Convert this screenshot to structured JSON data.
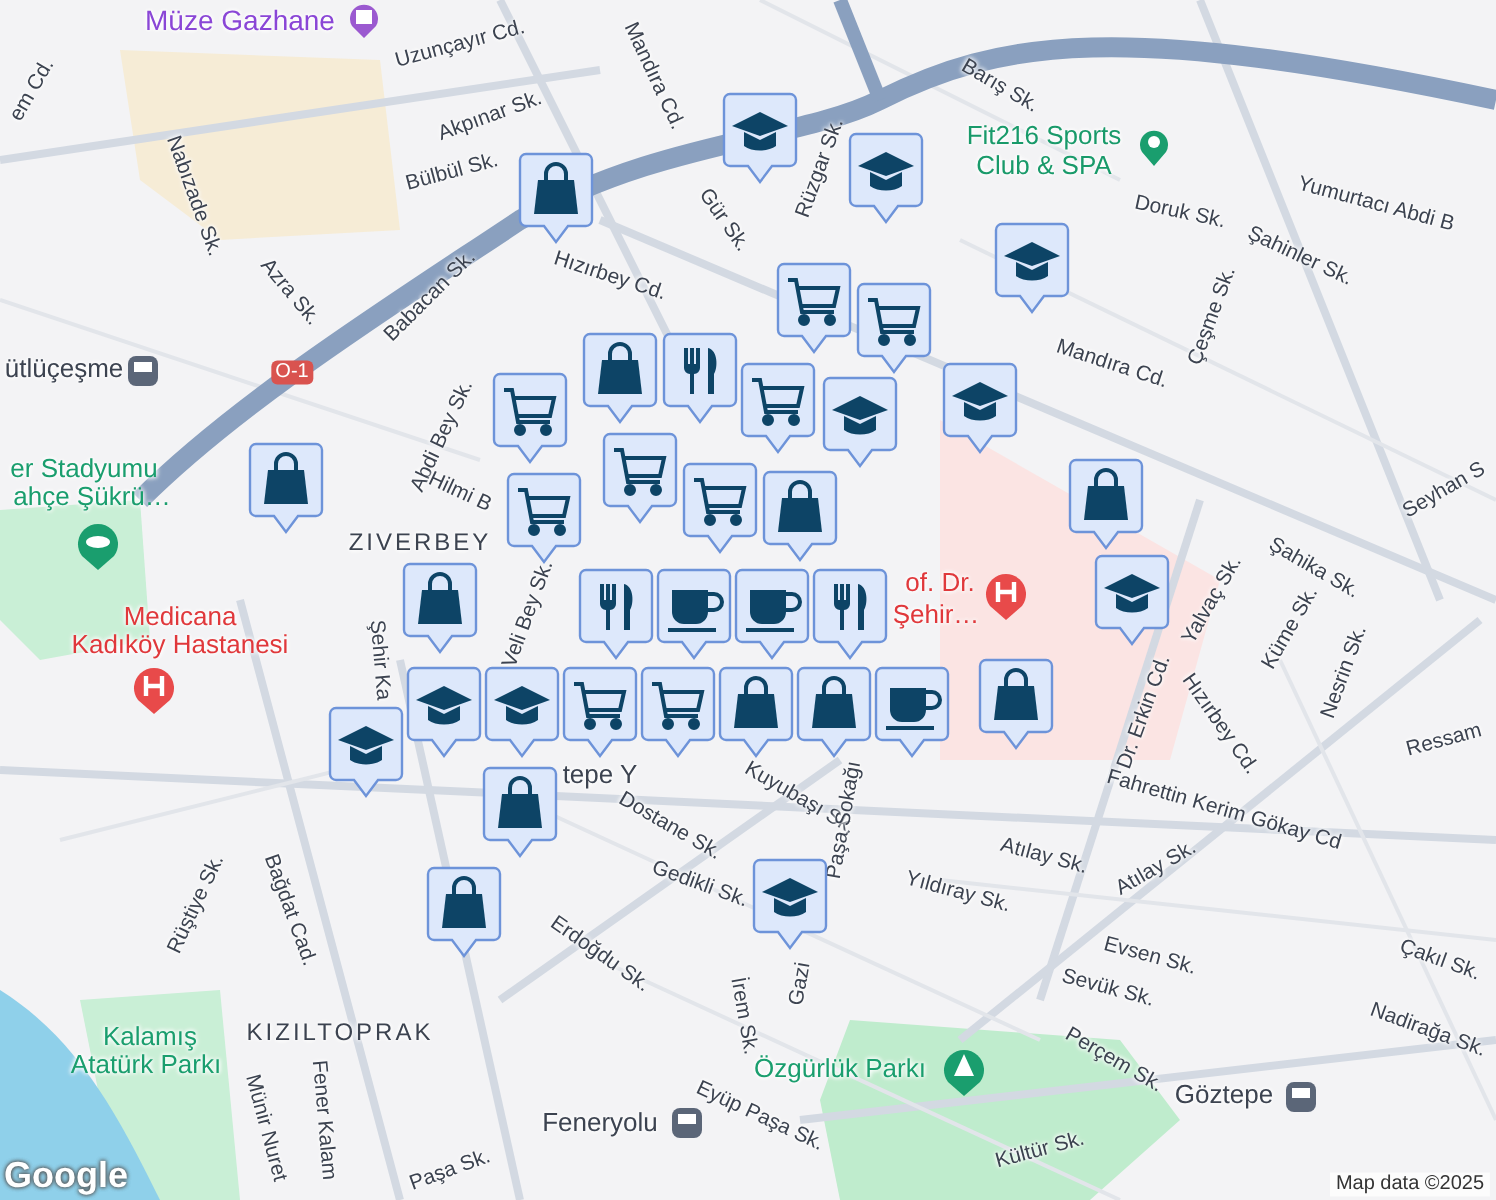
{
  "labels": [
    {
      "text": "em Cd.",
      "kind": "street"
    },
    {
      "text": "Müze Gazhane",
      "kind": "museum"
    },
    {
      "text": "Uzunçayır Cd.",
      "kind": "street"
    },
    {
      "text": "Mandıra Cd.",
      "kind": "street"
    },
    {
      "text": "Akpınar Sk.",
      "kind": "street"
    },
    {
      "text": "Bülbül Sk.",
      "kind": "street"
    },
    {
      "text": "Nabızade Sk.",
      "kind": "street"
    },
    {
      "text": "Azra Sk.",
      "kind": "street"
    },
    {
      "text": "Babacan Sk.",
      "kind": "street"
    },
    {
      "text": "Hızırbey Cd.",
      "kind": "street"
    },
    {
      "text": "Gür Sk.",
      "kind": "street"
    },
    {
      "text": "Rüzgar Sk.",
      "kind": "street"
    },
    {
      "text": "Barış Sk.",
      "kind": "street"
    },
    {
      "text": "Fit216 Sports Club & SPA",
      "kind": "sport"
    },
    {
      "text": "Doruk Sk.",
      "kind": "street"
    },
    {
      "text": "Şahinler Sk.",
      "kind": "street"
    },
    {
      "text": "Yumurtacı Abdi B",
      "kind": "street"
    },
    {
      "text": "Çeşme Sk.",
      "kind": "street"
    },
    {
      "text": "Mandıra Cd.",
      "kind": "street"
    },
    {
      "text": "Seyhan S",
      "kind": "street"
    },
    {
      "text": "Şahika Sk.",
      "kind": "street"
    },
    {
      "text": "ütlüçeşme",
      "kind": "station"
    },
    {
      "text": "er Stadyumu",
      "kind": "park"
    },
    {
      "text": "ahçe Şükrü…",
      "kind": "park"
    },
    {
      "text": "Abdi Bey Sk.",
      "kind": "street"
    },
    {
      "text": "Hilmi B",
      "kind": "street"
    },
    {
      "text": "ZIVERBEY",
      "kind": "district"
    },
    {
      "text": "Veli Bey Sk.",
      "kind": "street"
    },
    {
      "text": "of. Dr.",
      "kind": "hospital"
    },
    {
      "text": "Şehir…",
      "kind": "hospital"
    },
    {
      "text": "Medicana",
      "kind": "hospital"
    },
    {
      "text": "Kadıköy Hastanesi",
      "kind": "hospital"
    },
    {
      "text": "Şehir Ka",
      "kind": "street"
    },
    {
      "text": "tepe Y",
      "kind": "station"
    },
    {
      "text": "Dostane Sk.",
      "kind": "street"
    },
    {
      "text": "Kuyubaşı Sk.",
      "kind": "street"
    },
    {
      "text": "Gedikli Sk.",
      "kind": "street"
    },
    {
      "text": "Erdoğdu Sk.",
      "kind": "street"
    },
    {
      "text": "Rüştiye Sk.",
      "kind": "street"
    },
    {
      "text": "Bağdat Cad.",
      "kind": "street"
    },
    {
      "text": "İrem Sk.",
      "kind": "street"
    },
    {
      "text": "Paşa Sokağı",
      "kind": "street"
    },
    {
      "text": "Gazi",
      "kind": "street"
    },
    {
      "text": "Dr. Erkin Cd.",
      "kind": "street"
    },
    {
      "text": "Yalvaç Sk.",
      "kind": "street"
    },
    {
      "text": "Küme Sk.",
      "kind": "street"
    },
    {
      "text": "Nesrin Sk.",
      "kind": "street"
    },
    {
      "text": "Hızırbey Cd.",
      "kind": "street"
    },
    {
      "text": "Ressam",
      "kind": "street"
    },
    {
      "text": "Fahrettin Kerim Gökay Cd",
      "kind": "street"
    },
    {
      "text": "Atılay Sk.",
      "kind": "street"
    },
    {
      "text": "Atılay Sk.",
      "kind": "street"
    },
    {
      "text": "Yıldıray Sk.",
      "kind": "street"
    },
    {
      "text": "Evsen Sk.",
      "kind": "street"
    },
    {
      "text": "Sevük Sk.",
      "kind": "street"
    },
    {
      "text": "Çakıl Sk.",
      "kind": "street"
    },
    {
      "text": "Nadirağa Sk.",
      "kind": "street"
    },
    {
      "text": "Perçem Sk.",
      "kind": "street"
    },
    {
      "text": "KIZILTOPRAK",
      "kind": "district"
    },
    {
      "text": "Kalamış",
      "kind": "park"
    },
    {
      "text": "Atatürk Parkı",
      "kind": "park"
    },
    {
      "text": "Özgürlük Parkı",
      "kind": "park"
    },
    {
      "text": "Göztepe",
      "kind": "station"
    },
    {
      "text": "Feneryolu",
      "kind": "station"
    },
    {
      "text": "Eyüp Paşa Sk.",
      "kind": "street"
    },
    {
      "text": "Münir Nuret",
      "kind": "street"
    },
    {
      "text": "Fener Kalam",
      "kind": "street"
    },
    {
      "text": "Kültür Sk.",
      "kind": "street"
    },
    {
      "text": "Paşa Sk.",
      "kind": "street"
    },
    {
      "text": "Google",
      "kind": "logo"
    },
    {
      "text": "Map data ©2025",
      "kind": "attribution"
    },
    {
      "text": "O-1",
      "kind": "shield"
    }
  ],
  "markers": [
    {
      "kind": "school"
    },
    {
      "kind": "school"
    },
    {
      "kind": "shop"
    },
    {
      "kind": "school"
    },
    {
      "kind": "cart"
    },
    {
      "kind": "cart"
    },
    {
      "kind": "shop"
    },
    {
      "kind": "restaurant"
    },
    {
      "kind": "cart"
    },
    {
      "kind": "school"
    },
    {
      "kind": "school"
    },
    {
      "kind": "cart"
    },
    {
      "kind": "cart"
    },
    {
      "kind": "cart"
    },
    {
      "kind": "shop"
    },
    {
      "kind": "cart"
    },
    {
      "kind": "shop"
    },
    {
      "kind": "shop"
    },
    {
      "kind": "school"
    },
    {
      "kind": "restaurant"
    },
    {
      "kind": "cafe"
    },
    {
      "kind": "cafe"
    },
    {
      "kind": "restaurant"
    },
    {
      "kind": "shop"
    },
    {
      "kind": "cart"
    },
    {
      "kind": "cart"
    },
    {
      "kind": "school"
    },
    {
      "kind": "shop"
    },
    {
      "kind": "shop"
    },
    {
      "kind": "cafe"
    },
    {
      "kind": "school"
    },
    {
      "kind": "shop"
    },
    {
      "kind": "school"
    },
    {
      "kind": "shop"
    },
    {
      "kind": "shop"
    },
    {
      "kind": "school"
    }
  ]
}
